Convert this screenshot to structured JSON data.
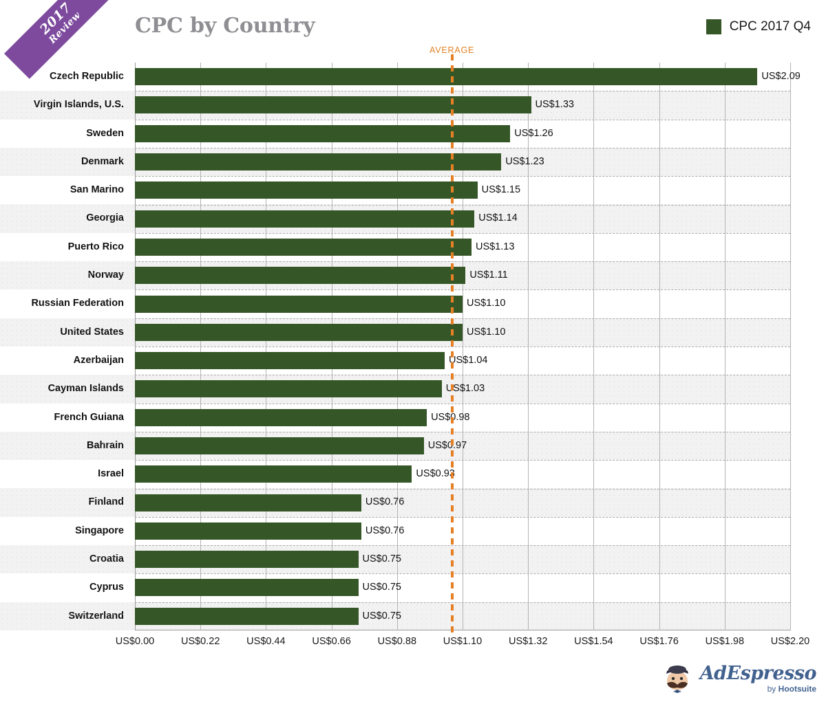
{
  "ribbon": {
    "year": "2017",
    "word": "Review"
  },
  "header": {
    "title": "CPC by Country",
    "legend_label": "CPC 2017 Q4",
    "legend_color": "#355626"
  },
  "average": {
    "label": "AVERAGE",
    "value": 1.0644,
    "color": "#e58026"
  },
  "logo": {
    "brand": "AdEspresso",
    "by": "by",
    "parent": "Hootsuite",
    "color": "#41618f"
  },
  "chart_data": {
    "type": "bar",
    "orientation": "horizontal",
    "title": "CPC by Country",
    "xlabel": "",
    "ylabel": "",
    "xlim": [
      0,
      2.2
    ],
    "grid": true,
    "legend_position": "top-right",
    "series": [
      {
        "name": "CPC 2017 Q4",
        "color": "#355626"
      }
    ],
    "tick_labels": [
      "US$0.00",
      "US$0.22",
      "US$0.44",
      "US$0.66",
      "US$0.88",
      "US$1.10",
      "US$1.32",
      "US$1.54",
      "US$1.76",
      "US$1.98",
      "US$2.20"
    ],
    "tick_values": [
      0,
      0.22,
      0.44,
      0.66,
      0.88,
      1.1,
      1.32,
      1.54,
      1.76,
      1.98,
      2.2
    ],
    "categories": [
      "Czech Republic",
      "Virgin Islands, U.S.",
      "Sweden",
      "Denmark",
      "San Marino",
      "Georgia",
      "Puerto Rico",
      "Norway",
      "Russian Federation",
      "United States",
      "Azerbaijan",
      "Cayman Islands",
      "French Guiana",
      "Bahrain",
      "Israel",
      "Finland",
      "Singapore",
      "Croatia",
      "Cyprus",
      "Switzerland"
    ],
    "values": [
      2.09,
      1.33,
      1.26,
      1.23,
      1.15,
      1.14,
      1.13,
      1.11,
      1.1,
      1.1,
      1.04,
      1.03,
      0.98,
      0.97,
      0.93,
      0.76,
      0.76,
      0.75,
      0.75,
      0.75
    ],
    "value_labels": [
      "US$2.09",
      "US$1.33",
      "US$1.26",
      "US$1.23",
      "US$1.15",
      "US$1.14",
      "US$1.13",
      "US$1.11",
      "US$1.10",
      "US$1.10",
      "US$1.04",
      "US$1.03",
      "US$0.98",
      "US$0.97",
      "US$0.93",
      "US$0.76",
      "US$0.76",
      "US$0.75",
      "US$0.75",
      "US$0.75"
    ],
    "annotations": [
      {
        "type": "vline",
        "label": "AVERAGE",
        "value": 1.0644,
        "color": "#e58026",
        "style": "dashed"
      }
    ]
  }
}
